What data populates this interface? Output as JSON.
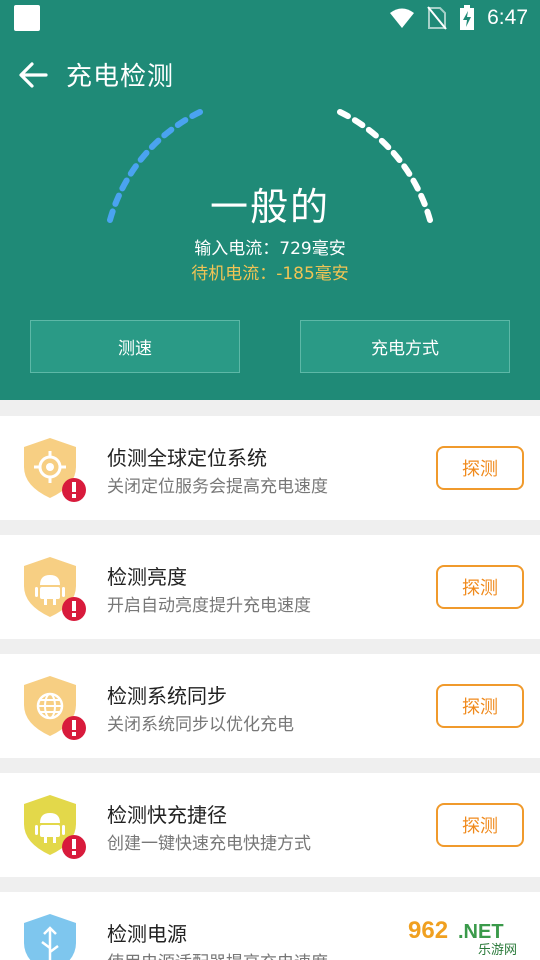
{
  "statusbar": {
    "time": "6:47"
  },
  "header": {
    "title": "充电检测"
  },
  "gauge": {
    "status": "一般的",
    "input_current": "输入电流：729毫安",
    "standby_current": "待机电流：-185毫安"
  },
  "actions": {
    "speed_label": "测速",
    "mode_label": "充电方式"
  },
  "cards": [
    {
      "title": "侦测全球定位系统",
      "desc": "关闭定位服务会提高充电速度",
      "button": "探测",
      "icon": "gps-shield-icon"
    },
    {
      "title": "检测亮度",
      "desc": "开启自动亮度提升充电速度",
      "button": "探测",
      "icon": "android-shield-icon"
    },
    {
      "title": "检测系统同步",
      "desc": "关闭系统同步以优化充电",
      "button": "探测",
      "icon": "globe-shield-icon"
    },
    {
      "title": "检测快充捷径",
      "desc": "创建一键快速充电快捷方式",
      "button": "探测",
      "icon": "android-shield-icon"
    },
    {
      "title": "检测电源",
      "desc": "使用电源适配器提高充电速度",
      "button": "",
      "icon": "usb-shield-icon"
    }
  ],
  "watermark": {
    "text": "962.NET",
    "subtext": "乐游网"
  },
  "colors": {
    "header_bg": "#1f8a77",
    "accent_orange": "#f08a1c",
    "warning_red": "#d81b3c",
    "standby_yellow": "#f0c455",
    "gauge_blue": "#4aa3f0"
  }
}
